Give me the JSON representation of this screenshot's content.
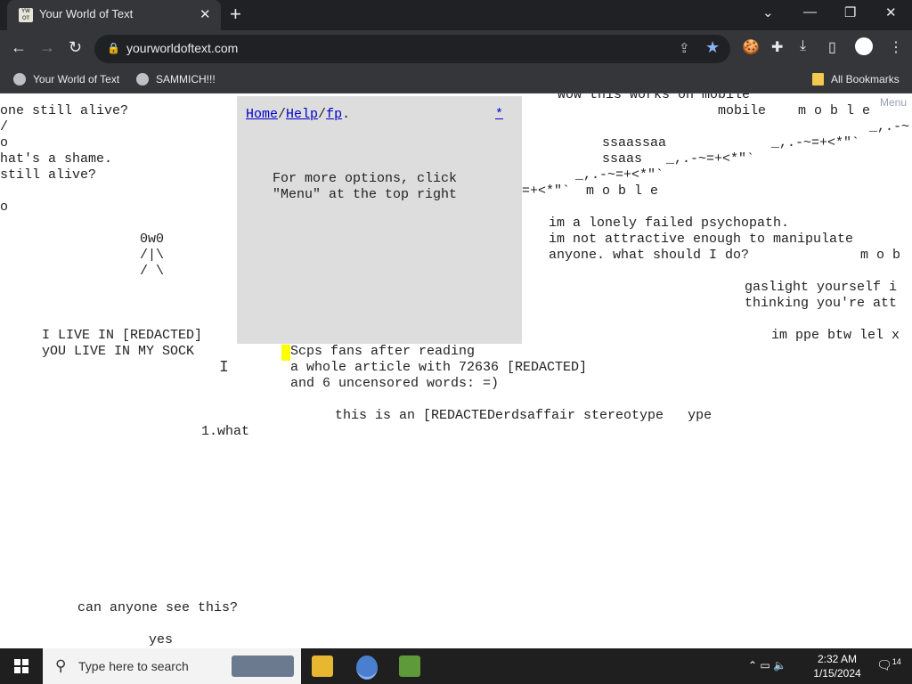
{
  "browser": {
    "tab_title": "Your World of Text",
    "tab_favicon_text": "YW OT",
    "new_tab_glyph": "+",
    "close_glyph": "✕",
    "url": "yourworldoftext.com",
    "window_controls": {
      "chevron": "⌄",
      "minimize": "—",
      "restore": "❐",
      "close": "✕"
    },
    "bookmarks": [
      {
        "label": "Your World of Text"
      },
      {
        "label": "SAMMICH!!!"
      }
    ],
    "all_bookmarks_label": "All Bookmarks"
  },
  "page": {
    "menu_label": "Menu",
    "popup": {
      "links": [
        "Home",
        "Help",
        "fp"
      ],
      "separator": "/",
      "end": ".",
      "star_link": "*",
      "message": "For more options, click\n\"Menu\" at the top right"
    },
    "text_lines": {
      "l01": "one still alive?",
      "l02": "/",
      "l03": "o",
      "l04": "hat's a shame.",
      "l05": "still alive?",
      "l06": "o",
      "l07": "0w0",
      "l08": "/|\\",
      "l09": "/ \\",
      "l10": "I LIVE IN [REDACTED]",
      "l11": "yOU LIVE IN MY SOCK",
      "l12": "Scps fans after reading",
      "l13": "a whole article with 72636 [REDACTED]",
      "l14": "and 6 uncensored words: =)",
      "l15": "this is an [REDACTEDerdsaffair stereotype   ype",
      "l16": "1.what",
      "l17": "can anyone see this?",
      "l18": "yes",
      "r01": "wow this works on mobile",
      "r02": "mobile    m o b l e",
      "r03": "ssaassaa",
      "r04": "ssaas   _,.-~=+<*\"`",
      "r05": "_,.-~=+<*\"`",
      "r06": "=+<*\"`  m o b l e",
      "r07": "_,.-~=+<*\"`",
      "r08": "_,.-~",
      "r09": "im a lonely failed psychopath.",
      "r10": "im not attractive enough to manipulate",
      "r11": "anyone. what should I do?",
      "r12": "m o b",
      "r13": "gaslight yourself i",
      "r14": "thinking you're att",
      "r15": "im ppe btw lel x"
    }
  },
  "taskbar": {
    "search_placeholder": "Type here to search",
    "time": "2:32 AM",
    "date": "1/15/2024",
    "notification_count": "14"
  },
  "colors": {
    "chrome_dark": "#202124",
    "chrome_toolbar": "#35363a",
    "popup_bg": "#dddddd",
    "cursor_highlight": "#ffff00",
    "link": "#0000cc"
  }
}
